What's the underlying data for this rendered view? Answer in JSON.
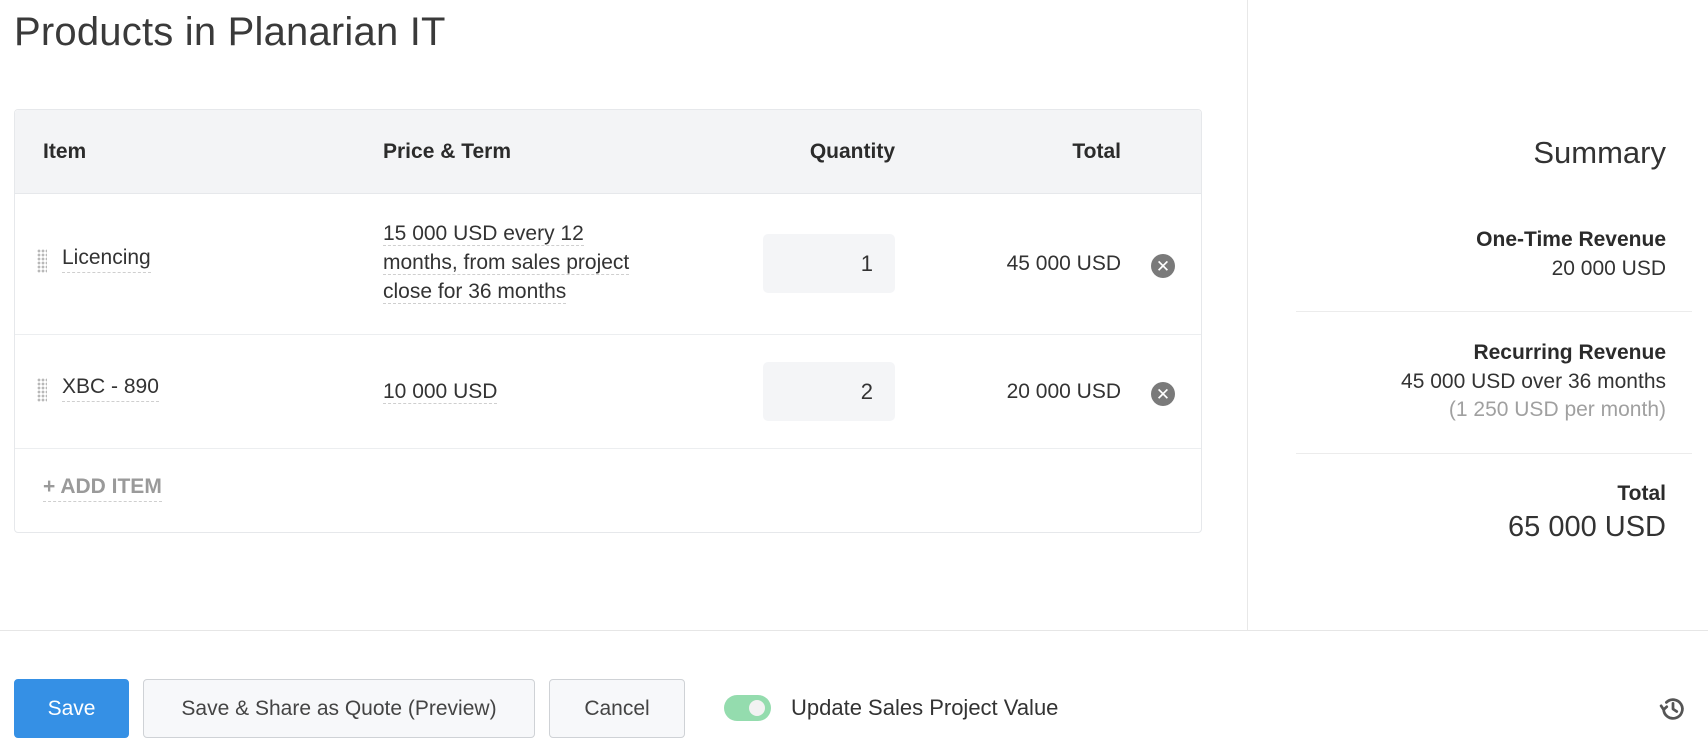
{
  "page": {
    "title": "Products in Planarian IT"
  },
  "table": {
    "headers": {
      "item": "Item",
      "price_term": "Price & Term",
      "quantity": "Quantity",
      "total": "Total"
    },
    "rows": [
      {
        "item": "Licencing",
        "price_term_lines": [
          "15 000 USD every 12",
          "months, from sales project",
          "close for 36 months"
        ],
        "quantity": "1",
        "total": "45 000 USD",
        "remove_icon": "close-circle-icon",
        "drag_icon": "drag-handle-icon"
      },
      {
        "item": "XBC - 890",
        "price_term_lines": [
          "10 000 USD"
        ],
        "quantity": "2",
        "total": "20 000 USD",
        "remove_icon": "close-circle-icon",
        "drag_icon": "drag-handle-icon"
      }
    ],
    "add_item_label": "+ ADD ITEM"
  },
  "summary": {
    "title": "Summary",
    "one_time": {
      "label": "One-Time Revenue",
      "value": "20 000 USD"
    },
    "recurring": {
      "label": "Recurring Revenue",
      "value": "45 000 USD over 36 months",
      "per_month": "(1 250 USD per month)"
    },
    "total": {
      "label": "Total",
      "value": "65 000 USD"
    }
  },
  "footer": {
    "save_label": "Save",
    "share_label": "Save & Share as Quote (Preview)",
    "cancel_label": "Cancel",
    "toggle": {
      "label": "Update Sales Project Value",
      "on": true
    },
    "history_icon": "history-icon"
  },
  "colors": {
    "primary": "#3590e5",
    "toggle_on": "#94dcae",
    "header_bg": "#f3f4f6",
    "muted_text": "#a0a0a0"
  }
}
